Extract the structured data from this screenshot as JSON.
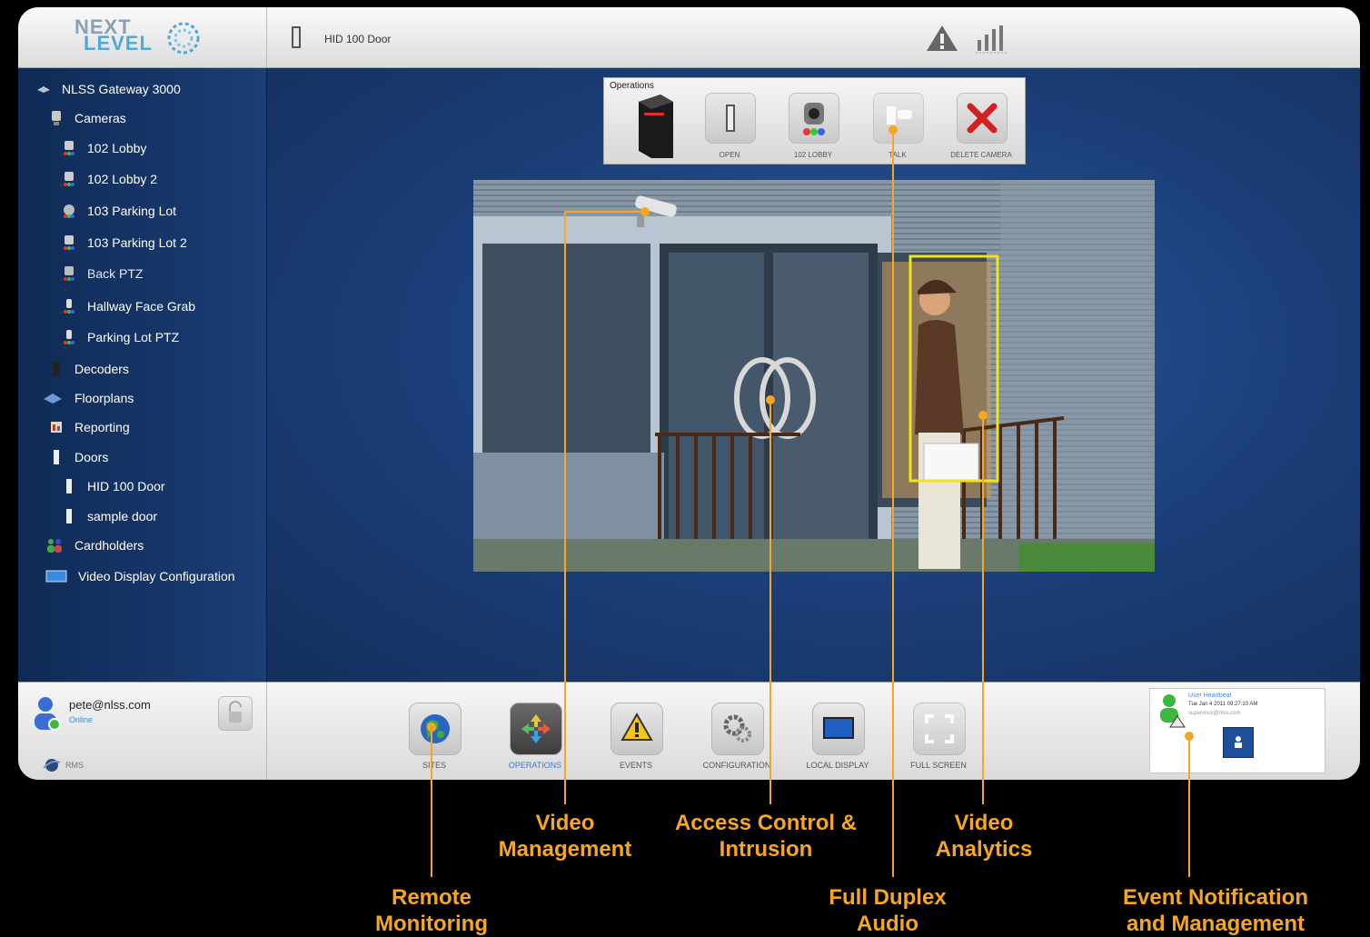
{
  "logo": {
    "line1": "NEXT",
    "line2": "LEVEL"
  },
  "header": {
    "title": "HID 100 Door",
    "icons": [
      "door-icon",
      "alert-icon",
      "signal-bars-icon"
    ]
  },
  "sidebar": {
    "items": [
      {
        "label": "NLSS Gateway 3000",
        "icon": "gateway-icon",
        "level": 0
      },
      {
        "label": "Cameras",
        "icon": "camera-group-icon",
        "level": 1
      },
      {
        "label": "102 Lobby",
        "icon": "camera-icon",
        "level": 2
      },
      {
        "label": "102 Lobby 2",
        "icon": "camera-icon",
        "level": 2
      },
      {
        "label": "103 Parking Lot",
        "icon": "ptz-camera-icon",
        "level": 2
      },
      {
        "label": "103 Parking Lot 2",
        "icon": "camera-icon",
        "level": 2
      },
      {
        "label": "Back PTZ",
        "icon": "camera-icon",
        "level": 2
      },
      {
        "label": "Hallway Face Grab",
        "icon": "dome-camera-icon",
        "level": 2
      },
      {
        "label": "Parking Lot PTZ",
        "icon": "dome-camera-icon",
        "level": 2
      },
      {
        "label": "Decoders",
        "icon": "decoder-icon",
        "level": 1
      },
      {
        "label": "Floorplans",
        "icon": "floorplan-icon",
        "level": 1
      },
      {
        "label": "Reporting",
        "icon": "reporting-icon",
        "level": 1
      },
      {
        "label": "Doors",
        "icon": "door-icon",
        "level": 1
      },
      {
        "label": "HID 100 Door",
        "icon": "door-icon",
        "level": 2
      },
      {
        "label": "sample door",
        "icon": "door-icon",
        "level": 2
      },
      {
        "label": "Cardholders",
        "icon": "cardholders-icon",
        "level": 1
      },
      {
        "label": "Video Display Configuration",
        "icon": "display-icon",
        "level": 1
      }
    ]
  },
  "operations": {
    "title": "Operations",
    "buttons": [
      {
        "label": "OPEN",
        "icon": "door-open-icon"
      },
      {
        "label": "102 LOBBY",
        "icon": "camera-icon"
      },
      {
        "label": "TALK",
        "icon": "talk-icon"
      },
      {
        "label": "DELETE CAMERA",
        "icon": "delete-icon"
      }
    ]
  },
  "user": {
    "name": "pete@nlss.com",
    "status": "Online",
    "site": "RMS"
  },
  "nav": {
    "buttons": [
      {
        "label": "SITES",
        "icon": "globe-icon",
        "active": false
      },
      {
        "label": "OPERATIONS",
        "icon": "arrows-icon",
        "active": true
      },
      {
        "label": "EVENTS",
        "icon": "warning-icon",
        "active": false
      },
      {
        "label": "CONFIGURATION",
        "icon": "gears-icon",
        "active": false
      },
      {
        "label": "LOCAL DISPLAY",
        "icon": "monitor-icon",
        "active": false
      },
      {
        "label": "FULL SCREEN",
        "icon": "fullscreen-icon",
        "active": false
      }
    ]
  },
  "notification": {
    "title": "User Heartbeat",
    "time": "Tue Jan 4 2011 09:27:10 AM",
    "email": "supervisor@nlss.com"
  },
  "callouts": {
    "remote": "Remote Monitoring",
    "video_mgmt": "Video Management",
    "access": "Access Control & Intrusion",
    "audio": "Full Duplex Audio",
    "analytics": "Video Analytics",
    "event": "Event Notification and Management"
  },
  "colors": {
    "accent": "#f5a623",
    "panel_blue": "#1c3f7a",
    "analytics_box": "#f2e21a"
  }
}
